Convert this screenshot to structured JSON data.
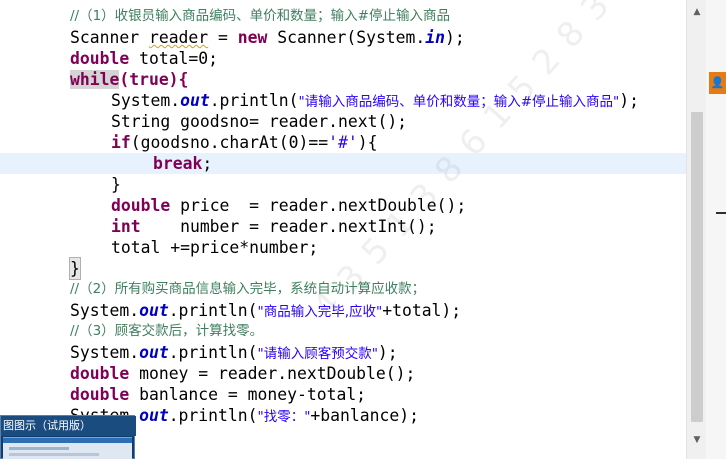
{
  "editor": {
    "lines": [
      {
        "id": "comment-1",
        "text": "//（1）收银员输入商品编码、单价和数量；输入#停止输入商品"
      },
      {
        "id": "scanner-decl",
        "text": "Scanner reader = new Scanner(System.in);"
      },
      {
        "id": "total-decl",
        "text": "double total=0;"
      },
      {
        "id": "while-loop",
        "text": "while(true){"
      },
      {
        "id": "println-prompt",
        "text": "System.out.println(\"请输入商品编码、单价和数量；输入#停止输入商品\");"
      },
      {
        "id": "goodsno-decl",
        "text": "String goodsno= reader.next();"
      },
      {
        "id": "if-check",
        "text": "if(goodsno.charAt(0)=='#'){"
      },
      {
        "id": "break-stmt",
        "text": "break;"
      },
      {
        "id": "if-close",
        "text": "}"
      },
      {
        "id": "price-decl",
        "text": "double price  = reader.nextDouble();"
      },
      {
        "id": "number-decl",
        "text": "int    number = reader.nextInt();"
      },
      {
        "id": "total-accum",
        "text": "total +=price*number;"
      },
      {
        "id": "while-close",
        "text": "}"
      },
      {
        "id": "comment-2",
        "text": "//（2）所有购买商品信息输入完毕，系统自动计算应收款；"
      },
      {
        "id": "println-total",
        "text": "System.out.println(\"商品输入完毕,应收\"+total);"
      },
      {
        "id": "comment-3",
        "text": "//（3）顾客交款后，计算找零。"
      },
      {
        "id": "println-pay",
        "text": "System.out.println(\"请输入顾客预交款\");"
      },
      {
        "id": "money-decl",
        "text": "double money = reader.nextDouble();"
      },
      {
        "id": "banlance-decl",
        "text": "double banlance = money-total;"
      },
      {
        "id": "println-change",
        "text": "System.out.println(\"找零：\"+banlance);"
      }
    ]
  },
  "tokens": {
    "scanner": "Scanner ",
    "reader": "reader",
    "eq_new": " = ",
    "new": "new",
    "scanner_ctor": " Scanner(System.",
    "in": "in",
    "close_paren_semi": ");",
    "double": "double",
    "total_rest": " total=0;",
    "while": "while",
    "while_rest": "(true){",
    "system": "System.",
    "out": "out",
    "println_open": ".println(",
    "prompt_str": "\"请输入商品编码、单价和数量；输入#停止输入商品\"",
    "string_kw": "String",
    "goodsno_rest": " goodsno= reader.next();",
    "if": "if",
    "if_rest": "(goodsno.charAt(0)==",
    "hash_char": "'#'",
    "if_end": "){",
    "break": "break",
    "semi": ";",
    "rbrace": "}",
    "price_rest": " price  = reader.nextDouble();",
    "int": "int",
    "number_rest": "    number = reader.nextInt();",
    "total_accum": "total +=price*number;",
    "total_str": "\"商品输入完毕,应收\"",
    "plus_total": "+total);",
    "pay_str": "\"请输入顾客预交款\"",
    "money_rest": " money = reader.nextDouble();",
    "banlance_rest": " banlance = money-total;",
    "change_str": "\"找零：\"",
    "plus_banlance": "+banlance);"
  },
  "watermark": "4 3 5 1 3 8 6 1 5 2 8 3 2 6 1 8 2",
  "scrollbar": {
    "up_arrow": "▲",
    "down_arrow": "▼"
  },
  "right_panel": {
    "icon": "user-icon",
    "glyph": "👤"
  },
  "taskbar_popup": {
    "title": "图图示（试用版）"
  }
}
